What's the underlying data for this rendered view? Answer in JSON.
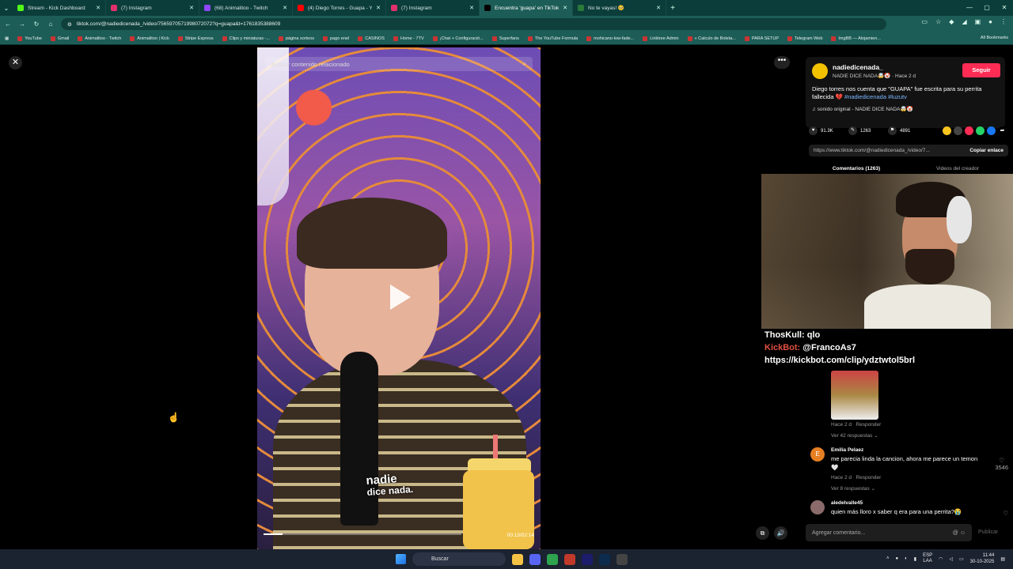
{
  "browser": {
    "tabs": [
      {
        "title": "Stream - Kick Dashboard",
        "color": "#53fc18",
        "active": false
      },
      {
        "title": "(7) Instagram",
        "color": "#e1306c",
        "active": false
      },
      {
        "title": "(68) Animalitoo - Twitch",
        "color": "#9146ff",
        "active": false
      },
      {
        "title": "(4) Diego Torres - Guapa - YouT",
        "color": "#ff0000",
        "active": false
      },
      {
        "title": "(7) Instagram",
        "color": "#e1306c",
        "active": false
      },
      {
        "title": "Encuentra 'guapa' en TikTok | B",
        "color": "#000000",
        "active": true
      },
      {
        "title": "No te vayas! 🥺",
        "color": "#2a7a3a",
        "active": false
      }
    ],
    "url": "tiktok.com/@nadiedicenada_/video/7565970571998072072?q=guapa&t=1761835388609",
    "bookmarks": [
      "YouTube",
      "Gmail",
      "Animalitoo - Twitch",
      "Animalitoo | Kick",
      "Stripe Express",
      "Clips y miniaturas -...",
      "página sorteos",
      "pago enel",
      "CASINOS",
      "Home - 7TV",
      "¡Chat + Configuració...",
      "Superfans",
      "The YouTube Formula",
      "mohicano-low-fade...",
      "Linktree Admin",
      "« Calculo de Boleta...",
      "PARA SETUP",
      "Telegram Web",
      "ImgBB — Alojamien..."
    ],
    "all_bookmarks": "All Bookmarks"
  },
  "video": {
    "search_placeholder": "Buscar contenido relacionado",
    "time": "00:13/02:14",
    "progress": 0.097,
    "overlay_logo_line1": "nadie",
    "overlay_logo_line2": "dice nada."
  },
  "author": {
    "name": "nadiedicenada_",
    "subtitle": "NADIE DICE NADA🤯🤡 · Hace 2 d",
    "follow_label": "Seguir",
    "description": "Diego torres nos cuenta que \"GUAPA\" fue escrita para su perrita fallecida 💔",
    "hashtags": "#nadiedicenada #luzutv",
    "sound": "♫ sonido original - NADIE DICE NADA🤯🤡"
  },
  "stats": {
    "likes": "91.3K",
    "comments": "1263",
    "saves": "4891"
  },
  "link": {
    "url": "https://www.tiktok.com/@nadiedicenada_/video/7...",
    "copy_label": "Copiar enlace"
  },
  "tabs": {
    "comments": "Comentarios (1263)",
    "creator_videos": "Videos del creador"
  },
  "kick_chat": [
    {
      "user": "ThosKull:",
      "message": "qlo"
    },
    {
      "user": "KickBot:",
      "message": "@FrancoAs7"
    },
    {
      "user": "",
      "message": "https://kickbot.com/clip/ydztwtol5brl"
    }
  ],
  "comments": [
    {
      "meta": "Hace 2 d",
      "reply": "Responder",
      "replies": "Ver 42 respuestas ⌄"
    },
    {
      "name": "Emilia Pelaez",
      "text": "me parecia linda la cancion, ahora me parece un temon 🤍",
      "meta": "Hace 2 d",
      "reply": "Responder",
      "replies": "Ver 8 respuestas ⌄",
      "likes": "3546"
    },
    {
      "name": "aledelvalle45",
      "text": "quien más lloro x saber q era para una perrita?😭"
    }
  ],
  "comment_input": {
    "placeholder": "Agregar comentario...",
    "publish": "Publicar"
  },
  "taskbar": {
    "search": "Buscar",
    "lang": "ESP",
    "lang2": "LAA",
    "time": "11:44",
    "date": "30-10-2025"
  }
}
